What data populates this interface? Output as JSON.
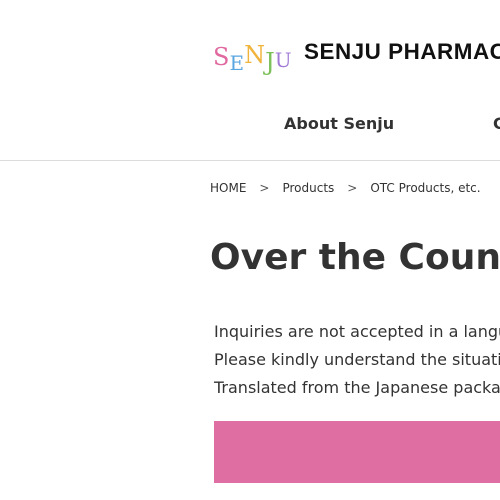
{
  "header": {
    "logo_mark_letters": [
      "S",
      "E",
      "N",
      "J",
      "U"
    ],
    "logo_text": "SENJU PHARMACE"
  },
  "nav": {
    "items": [
      {
        "label": "About Senju"
      },
      {
        "label": "C"
      }
    ]
  },
  "breadcrumb": {
    "items": [
      {
        "label": "HOME"
      },
      {
        "label": "Products"
      },
      {
        "label": "OTC Products, etc."
      }
    ],
    "separator": ">"
  },
  "main": {
    "title": "Over the Counte",
    "notice_lines": [
      "Inquiries are not accepted in a langua",
      "Please kindly understand the situation",
      "Translated from the Japanese packag"
    ]
  },
  "colors": {
    "banner": "#df6fa2",
    "text": "#333333",
    "divider": "#dcdcdc"
  }
}
